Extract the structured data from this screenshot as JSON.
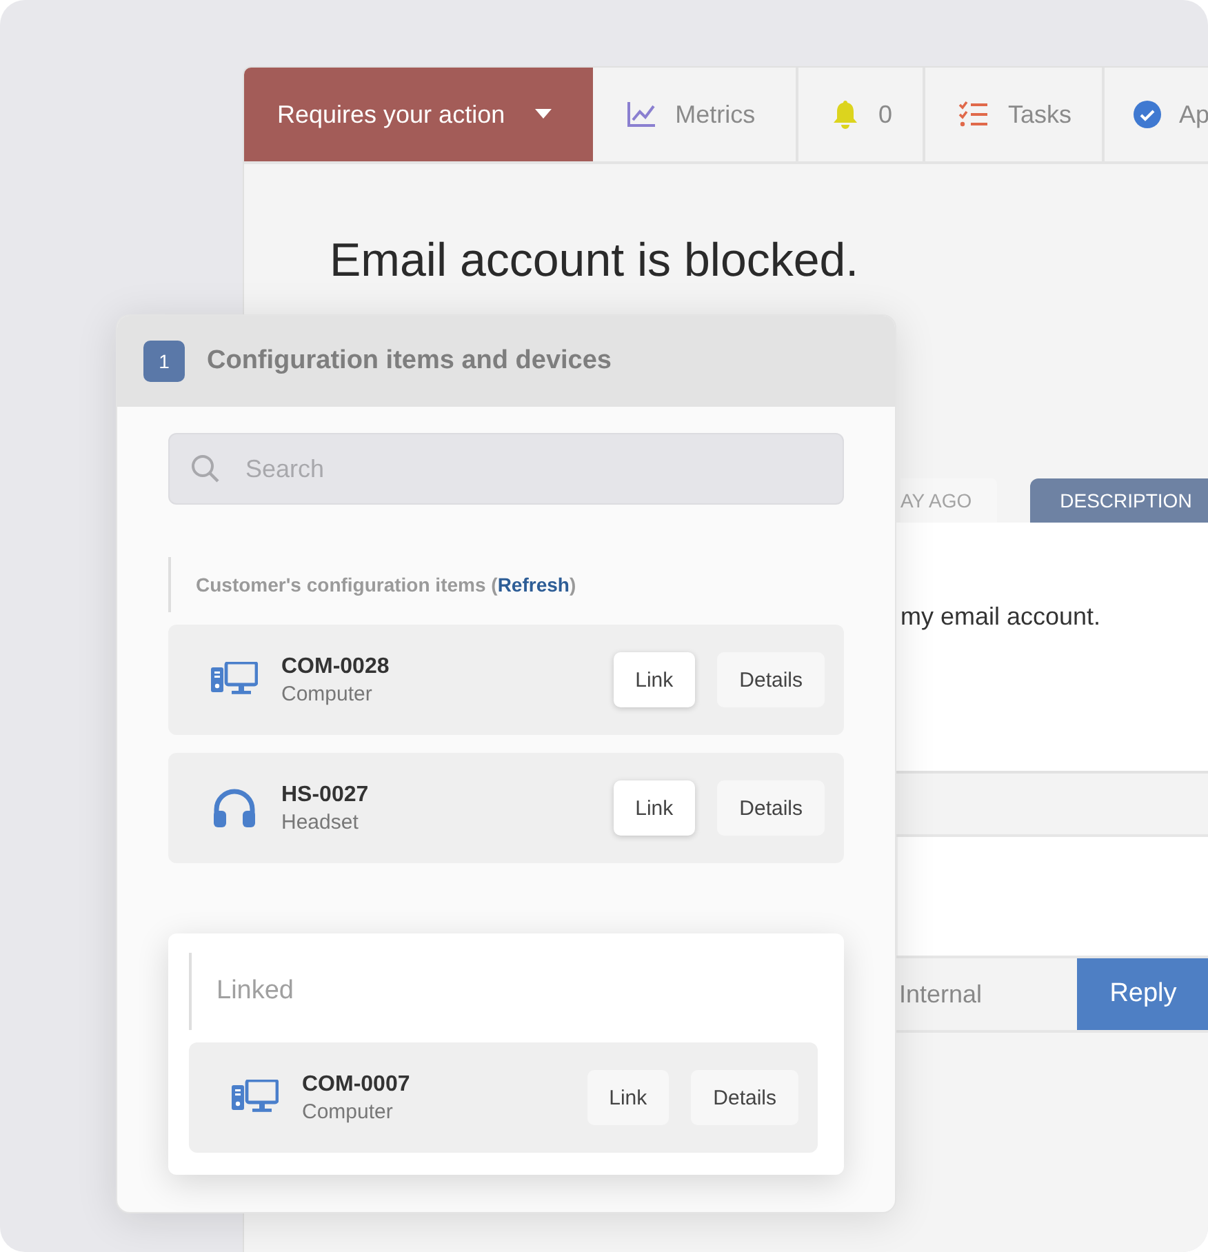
{
  "tabs": [
    {
      "label": "Requires your action",
      "selected": true
    },
    {
      "label": "Metrics",
      "selected": false
    },
    {
      "label": "0",
      "selected": false
    },
    {
      "label": "Tasks",
      "selected": false
    },
    {
      "label": "Ap",
      "selected": false
    }
  ],
  "ticket": {
    "title": "Email account is blocked.",
    "detail_tabs": [
      {
        "label": "AY AGO",
        "selected": false
      },
      {
        "label": "DESCRIPTION",
        "selected": true
      }
    ],
    "description": "my email account.",
    "reply_tabs": [
      {
        "label": "Internal",
        "selected": false
      },
      {
        "label": "Reply",
        "selected": true
      }
    ]
  },
  "panel": {
    "step": "1",
    "title": "Configuration items and devices",
    "search": {
      "placeholder": "Search"
    },
    "customer_section": {
      "label": "Customer's configuration items (",
      "link": "Refresh",
      "label_end": ")",
      "items": [
        {
          "kind": "computer",
          "name": "COM-0028",
          "type": "Computer",
          "buttons": [
            "Link",
            "Details"
          ]
        },
        {
          "kind": "headset",
          "name": "HS-0027",
          "type": "Headset",
          "buttons": [
            "Link",
            "Details"
          ]
        }
      ]
    },
    "linked_section": {
      "label": "Linked",
      "items": [
        {
          "kind": "computer",
          "name": "COM-0007",
          "type": "Computer",
          "buttons": [
            "Link",
            "Details"
          ]
        }
      ]
    }
  }
}
